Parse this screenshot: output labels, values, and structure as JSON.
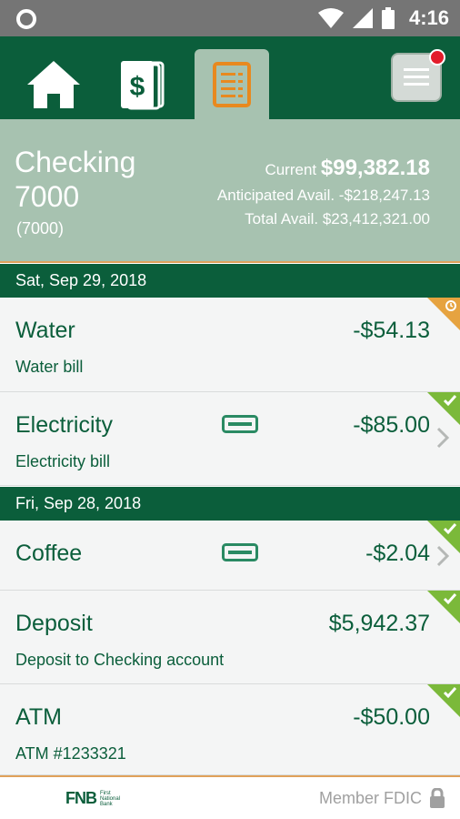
{
  "status_bar": {
    "time": "4:16",
    "icons": [
      "circle-icon",
      "wifi-icon",
      "signal-icon",
      "battery-icon"
    ]
  },
  "nav": {
    "tabs": [
      {
        "name": "home",
        "icon": "home-icon"
      },
      {
        "name": "transfer",
        "icon": "dollar-cards-icon"
      },
      {
        "name": "activity",
        "icon": "list-document-icon",
        "active": true
      }
    ],
    "menu_icon": "hamburger-menu-icon",
    "menu_badge": true
  },
  "account": {
    "name": "Checking 7000",
    "number": "(7000)",
    "current_label": "Current",
    "current_value": "$99,382.18",
    "anticipated": "Anticipated Avail. -$218,247.13",
    "total": "Total Avail. $23,412,321.00"
  },
  "groups": [
    {
      "date": "Sat, Sep 29, 2018",
      "transactions": [
        {
          "name": "Water",
          "description": "Water bill",
          "amount": "-$54.13",
          "status": "pending"
        },
        {
          "name": "Electricity",
          "description": "Electricity bill",
          "amount": "-$85.00",
          "status": "cleared",
          "card": true,
          "chevron": true
        }
      ]
    },
    {
      "date": "Fri, Sep 28, 2018",
      "transactions": [
        {
          "name": "Coffee",
          "description": "",
          "amount": "-$2.04",
          "status": "cleared",
          "card": true,
          "chevron": true
        },
        {
          "name": "Deposit",
          "description": "Deposit to Checking account",
          "amount": "$5,942.37",
          "status": "cleared"
        },
        {
          "name": "ATM",
          "description": "ATM #1233321",
          "amount": "-$50.00",
          "status": "cleared"
        }
      ]
    }
  ],
  "footer": {
    "logo_text": "FNB",
    "logo_tagline": "First National Bank",
    "member": "Member FDIC"
  },
  "colors": {
    "brand_green": "#0b5e3b",
    "header_sage": "#a7c2b0",
    "accent_orange": "#e0a15a",
    "cleared_green": "#7bb93a",
    "pending_orange": "#e6a340",
    "badge_red": "#e31d2b"
  }
}
